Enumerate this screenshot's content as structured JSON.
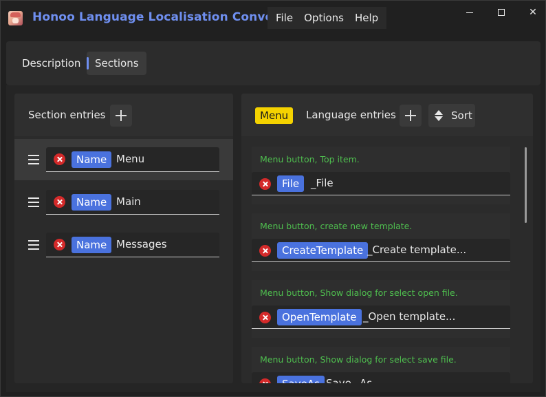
{
  "window": {
    "title": "Honoo Language Localisation Converter",
    "menu": [
      "File",
      "Options",
      "Help"
    ],
    "controls": {
      "minimize": "minimize-icon",
      "maximize": "maximize-icon",
      "close": "✕"
    }
  },
  "tabs": [
    {
      "label": "Description",
      "selected": false
    },
    {
      "label": "Sections",
      "selected": true
    }
  ],
  "sections_panel": {
    "title": "Section entries",
    "add_icon": "plus-icon",
    "items": [
      {
        "chip": "Name",
        "value": "Menu",
        "selected": true
      },
      {
        "chip": "Name",
        "value": "Main",
        "selected": false
      },
      {
        "chip": "Name",
        "value": "Messages",
        "selected": false
      }
    ]
  },
  "entries_panel": {
    "section_badge": "Menu",
    "title": "Language entries",
    "add_icon": "plus-icon",
    "sort_label": "Sort",
    "entries": [
      {
        "comment": "Menu button, Top item.",
        "key": "File",
        "value": "_File"
      },
      {
        "comment": "Menu button, create new template.",
        "key": "CreateTemplate",
        "value": "_Create template..."
      },
      {
        "comment": "Menu button, Show dialog for select open file.",
        "key": "OpenTemplate",
        "value": "_Open template..."
      },
      {
        "comment": "Menu button, Show dialog for select save file.",
        "key": "SaveAs",
        "value": "Save _As..."
      }
    ]
  },
  "colors": {
    "accent": "#4a72de",
    "title": "#6f8ff0",
    "badge": "#f4d200",
    "comment": "#4fbf4f",
    "delete": "#d42a2a"
  }
}
